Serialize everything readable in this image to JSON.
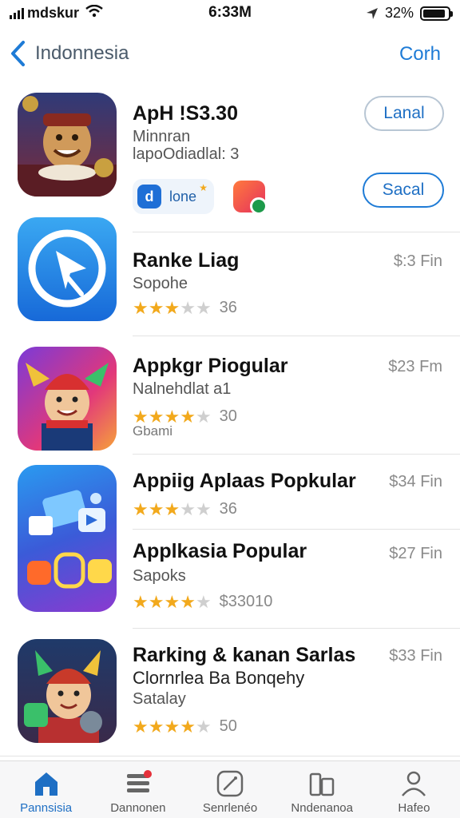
{
  "status": {
    "carrier": "mdskur",
    "time": "6:33M",
    "battery": "32%",
    "battery_level": 0.9
  },
  "nav": {
    "back_label": "Indonnesia",
    "right_label": "Corh"
  },
  "apps": [
    {
      "title": "ApH !S3.30",
      "subtitle": "Minnran",
      "subtitle2": "lapoOdiadlal: 3",
      "button1": "Lanal",
      "button2": "Sacal",
      "chip_label": "lone",
      "chip_logo": "d"
    },
    {
      "title": "Ranke Liag",
      "subtitle": "Sopohe",
      "price": "$:3 Fin",
      "rating": 2.5,
      "count": "36"
    },
    {
      "title": "Appkgr Piogular",
      "subtitle": "Nalnehdlat a1",
      "extra": "Gbami",
      "price": "$23 Fm",
      "rating": 3.5,
      "count": "30"
    },
    {
      "title": "Appiig Aplaas Popkular",
      "price": "$34 Fin",
      "rating": 2.5,
      "count": "36"
    },
    {
      "title": "Applkasia  Popular",
      "subtitle": "Sapoks",
      "price": "$27 Fin",
      "rating": 4,
      "count": "$33010"
    },
    {
      "title": "Rarking & kanan  Sarlas",
      "subtitle": "Clornrlea Ba Bonqehy",
      "extra": "Satalay",
      "price": "$33 Fin",
      "rating": 3.5,
      "count": "50"
    }
  ],
  "tabs": [
    {
      "label": "Pannsisia",
      "icon": "home-icon"
    },
    {
      "label": "Dannonen",
      "icon": "list-icon"
    },
    {
      "label": "Senrlenéo",
      "icon": "slash-square-icon"
    },
    {
      "label": "Nndenanoa",
      "icon": "books-icon"
    },
    {
      "label": "Hafeo",
      "icon": "person-icon"
    }
  ],
  "colors": {
    "accent": "#1e7bd6",
    "star": "#f2a91c"
  }
}
